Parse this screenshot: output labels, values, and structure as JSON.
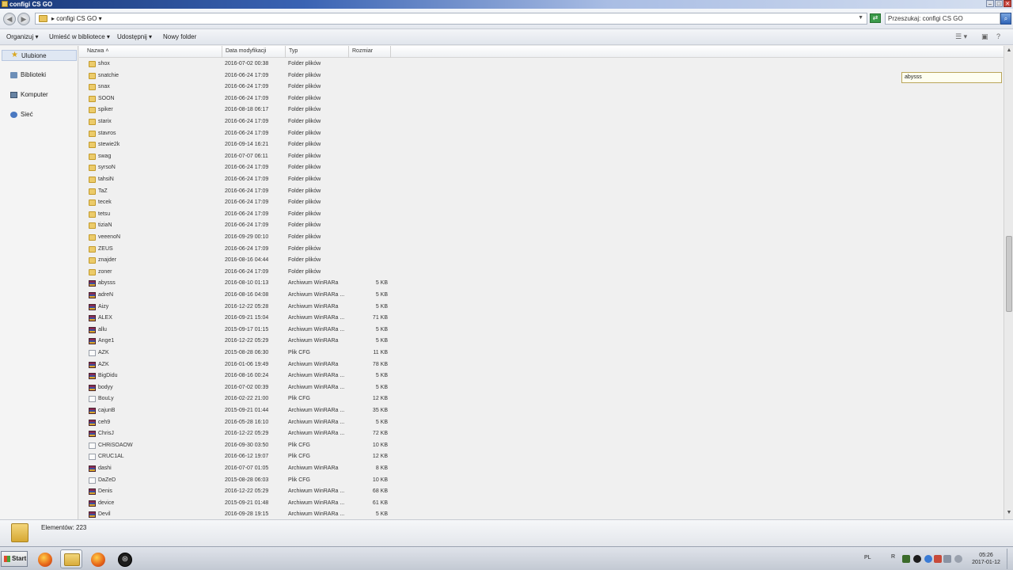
{
  "window": {
    "title": "configi CS GO"
  },
  "address": {
    "path": "configi CS GO",
    "crumb_prefix": "▸"
  },
  "search": {
    "placeholder": "Przeszukaj: configi CS GO"
  },
  "toolbar": {
    "organize": "Organizuj",
    "include_library": "Umieść w bibliotece",
    "share": "Udostępnij",
    "new_folder": "Nowy folder"
  },
  "sidebar": {
    "items": [
      {
        "label": "Ulubione",
        "icon": "star-icon"
      },
      {
        "label": "Biblioteki",
        "icon": "library-icon"
      },
      {
        "label": "Komputer",
        "icon": "computer-icon"
      },
      {
        "label": "Sieć",
        "icon": "network-icon"
      }
    ]
  },
  "columns": {
    "name": "Nazwa",
    "date": "Data modyfikacji",
    "type": "Typ",
    "size": "Rozmiar"
  },
  "rename_value": "abysss",
  "files": [
    {
      "name": "shox",
      "date": "2016-07-02 00:38",
      "type": "Folder plików",
      "size": "",
      "kind": "folder"
    },
    {
      "name": "snatchie",
      "date": "2016-06-24 17:09",
      "type": "Folder plików",
      "size": "",
      "kind": "folder"
    },
    {
      "name": "snax",
      "date": "2016-06-24 17:09",
      "type": "Folder plików",
      "size": "",
      "kind": "folder"
    },
    {
      "name": "SOON",
      "date": "2016-06-24 17:09",
      "type": "Folder plików",
      "size": "",
      "kind": "folder"
    },
    {
      "name": "spiker",
      "date": "2016-08-18 06:17",
      "type": "Folder plików",
      "size": "",
      "kind": "folder"
    },
    {
      "name": "starix",
      "date": "2016-06-24 17:09",
      "type": "Folder plików",
      "size": "",
      "kind": "folder"
    },
    {
      "name": "stavros",
      "date": "2016-06-24 17:09",
      "type": "Folder plików",
      "size": "",
      "kind": "folder"
    },
    {
      "name": "stewie2k",
      "date": "2016-09-14 16:21",
      "type": "Folder plików",
      "size": "",
      "kind": "folder"
    },
    {
      "name": "swag",
      "date": "2016-07-07 06:11",
      "type": "Folder plików",
      "size": "",
      "kind": "folder"
    },
    {
      "name": "syrsoN",
      "date": "2016-06-24 17:09",
      "type": "Folder plików",
      "size": "",
      "kind": "folder"
    },
    {
      "name": "tahsiN",
      "date": "2016-06-24 17:09",
      "type": "Folder plików",
      "size": "",
      "kind": "folder"
    },
    {
      "name": "TaZ",
      "date": "2016-06-24 17:09",
      "type": "Folder plików",
      "size": "",
      "kind": "folder"
    },
    {
      "name": "tecek",
      "date": "2016-06-24 17:09",
      "type": "Folder plików",
      "size": "",
      "kind": "folder"
    },
    {
      "name": "tetsu",
      "date": "2016-06-24 17:09",
      "type": "Folder plików",
      "size": "",
      "kind": "folder"
    },
    {
      "name": "tiziaN",
      "date": "2016-06-24 17:09",
      "type": "Folder plików",
      "size": "",
      "kind": "folder"
    },
    {
      "name": "veeenoN",
      "date": "2016-09-29 00:10",
      "type": "Folder plików",
      "size": "",
      "kind": "folder"
    },
    {
      "name": "ZEUS",
      "date": "2016-06-24 17:09",
      "type": "Folder plików",
      "size": "",
      "kind": "folder"
    },
    {
      "name": "znajder",
      "date": "2016-08-16 04:44",
      "type": "Folder plików",
      "size": "",
      "kind": "folder"
    },
    {
      "name": "zoner",
      "date": "2016-06-24 17:09",
      "type": "Folder plików",
      "size": "",
      "kind": "folder"
    },
    {
      "name": "abysss",
      "date": "2016-08-10 01:13",
      "type": "Archiwum WinRARa",
      "size": "5 KB",
      "kind": "rar"
    },
    {
      "name": "adreN",
      "date": "2016-08-16 04:08",
      "type": "Archiwum WinRARa ...",
      "size": "5 KB",
      "kind": "rar"
    },
    {
      "name": "Aizy",
      "date": "2016-12-22 05:28",
      "type": "Archiwum WinRARa",
      "size": "5 KB",
      "kind": "rar"
    },
    {
      "name": "ALEX",
      "date": "2016-09-21 15:04",
      "type": "Archiwum WinRARa ...",
      "size": "71 KB",
      "kind": "rar"
    },
    {
      "name": "allu",
      "date": "2015-09-17 01:15",
      "type": "Archiwum WinRARa ...",
      "size": "5 KB",
      "kind": "rar"
    },
    {
      "name": "Ange1",
      "date": "2016-12-22 05:29",
      "type": "Archiwum WinRARa",
      "size": "5 KB",
      "kind": "rar"
    },
    {
      "name": "AZK",
      "date": "2015-08-28 06:30",
      "type": "Plik CFG",
      "size": "11 KB",
      "kind": "cfg"
    },
    {
      "name": "AZK",
      "date": "2016-01-06 19:49",
      "type": "Archiwum WinRARa",
      "size": "78 KB",
      "kind": "rar"
    },
    {
      "name": "BigDidu",
      "date": "2016-08-16 00:24",
      "type": "Archiwum WinRARa ...",
      "size": "5 KB",
      "kind": "rar"
    },
    {
      "name": "bodyy",
      "date": "2016-07-02 00:39",
      "type": "Archiwum WinRARa ...",
      "size": "5 KB",
      "kind": "rar"
    },
    {
      "name": "BouLy",
      "date": "2016-02-22 21:00",
      "type": "Plik CFG",
      "size": "12 KB",
      "kind": "cfg"
    },
    {
      "name": "cajunB",
      "date": "2015-09-21 01:44",
      "type": "Archiwum WinRARa ...",
      "size": "35 KB",
      "kind": "rar"
    },
    {
      "name": "ceh9",
      "date": "2016-05-28 16:10",
      "type": "Archiwum WinRARa ...",
      "size": "5 KB",
      "kind": "rar"
    },
    {
      "name": "ChrisJ",
      "date": "2016-12-22 05:29",
      "type": "Archiwum WinRARa ...",
      "size": "72 KB",
      "kind": "rar"
    },
    {
      "name": "CHRiSOAOW",
      "date": "2016-09-30 03:50",
      "type": "Plik CFG",
      "size": "10 KB",
      "kind": "cfg"
    },
    {
      "name": "CRUC1AL",
      "date": "2016-06-12 19:07",
      "type": "Plik CFG",
      "size": "12 KB",
      "kind": "cfg"
    },
    {
      "name": "dashi",
      "date": "2016-07-07 01:05",
      "type": "Archiwum WinRARa",
      "size": "8 KB",
      "kind": "rar"
    },
    {
      "name": "DaZeD",
      "date": "2015-08-28 06:03",
      "type": "Plik CFG",
      "size": "10 KB",
      "kind": "cfg"
    },
    {
      "name": "Denis",
      "date": "2016-12-22 05:29",
      "type": "Archiwum WinRARa ...",
      "size": "68 KB",
      "kind": "rar"
    },
    {
      "name": "device",
      "date": "2015-09-21 01:48",
      "type": "Archiwum WinRARa ...",
      "size": "61 KB",
      "kind": "rar"
    },
    {
      "name": "Devil",
      "date": "2016-09-28 19:15",
      "type": "Archiwum WinRARa ...",
      "size": "5 KB",
      "kind": "rar"
    }
  ],
  "status": {
    "items_label": "Elementów: 223"
  },
  "taskbar": {
    "start_label": "Start",
    "language": "PL",
    "tray_letter": "R",
    "time": "05:26",
    "date": "2017-01-12"
  }
}
